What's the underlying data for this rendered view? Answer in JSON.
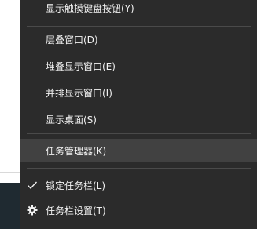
{
  "menu": {
    "items": [
      {
        "label": "显示触摸键盘按钮(Y)"
      },
      {
        "label": "层叠窗口(D)"
      },
      {
        "label": "堆叠显示窗口(E)"
      },
      {
        "label": "并排显示窗口(I)"
      },
      {
        "label": "显示桌面(S)"
      },
      {
        "label": "任务管理器(K)"
      },
      {
        "label": "锁定任务栏(L)",
        "checked": true,
        "icon": "checkmark-icon"
      },
      {
        "label": "任务栏设置(T)",
        "icon": "gear-icon"
      }
    ],
    "highlighted_index": 5,
    "colors": {
      "background": "#2b2b2b",
      "hover": "#414141",
      "text": "#f2f2f2",
      "separator": "#4a4a4a"
    }
  }
}
